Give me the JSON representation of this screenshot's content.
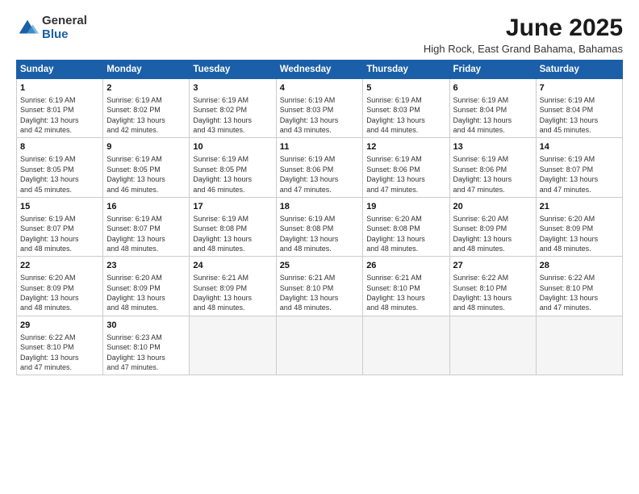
{
  "logo": {
    "general": "General",
    "blue": "Blue"
  },
  "title": "June 2025",
  "subtitle": "High Rock, East Grand Bahama, Bahamas",
  "weekdays": [
    "Sunday",
    "Monday",
    "Tuesday",
    "Wednesday",
    "Thursday",
    "Friday",
    "Saturday"
  ],
  "weeks": [
    [
      {
        "day": "1",
        "info": "Sunrise: 6:19 AM\nSunset: 8:01 PM\nDaylight: 13 hours\nand 42 minutes."
      },
      {
        "day": "2",
        "info": "Sunrise: 6:19 AM\nSunset: 8:02 PM\nDaylight: 13 hours\nand 42 minutes."
      },
      {
        "day": "3",
        "info": "Sunrise: 6:19 AM\nSunset: 8:02 PM\nDaylight: 13 hours\nand 43 minutes."
      },
      {
        "day": "4",
        "info": "Sunrise: 6:19 AM\nSunset: 8:03 PM\nDaylight: 13 hours\nand 43 minutes."
      },
      {
        "day": "5",
        "info": "Sunrise: 6:19 AM\nSunset: 8:03 PM\nDaylight: 13 hours\nand 44 minutes."
      },
      {
        "day": "6",
        "info": "Sunrise: 6:19 AM\nSunset: 8:04 PM\nDaylight: 13 hours\nand 44 minutes."
      },
      {
        "day": "7",
        "info": "Sunrise: 6:19 AM\nSunset: 8:04 PM\nDaylight: 13 hours\nand 45 minutes."
      }
    ],
    [
      {
        "day": "8",
        "info": "Sunrise: 6:19 AM\nSunset: 8:05 PM\nDaylight: 13 hours\nand 45 minutes."
      },
      {
        "day": "9",
        "info": "Sunrise: 6:19 AM\nSunset: 8:05 PM\nDaylight: 13 hours\nand 46 minutes."
      },
      {
        "day": "10",
        "info": "Sunrise: 6:19 AM\nSunset: 8:05 PM\nDaylight: 13 hours\nand 46 minutes."
      },
      {
        "day": "11",
        "info": "Sunrise: 6:19 AM\nSunset: 8:06 PM\nDaylight: 13 hours\nand 47 minutes."
      },
      {
        "day": "12",
        "info": "Sunrise: 6:19 AM\nSunset: 8:06 PM\nDaylight: 13 hours\nand 47 minutes."
      },
      {
        "day": "13",
        "info": "Sunrise: 6:19 AM\nSunset: 8:06 PM\nDaylight: 13 hours\nand 47 minutes."
      },
      {
        "day": "14",
        "info": "Sunrise: 6:19 AM\nSunset: 8:07 PM\nDaylight: 13 hours\nand 47 minutes."
      }
    ],
    [
      {
        "day": "15",
        "info": "Sunrise: 6:19 AM\nSunset: 8:07 PM\nDaylight: 13 hours\nand 48 minutes."
      },
      {
        "day": "16",
        "info": "Sunrise: 6:19 AM\nSunset: 8:07 PM\nDaylight: 13 hours\nand 48 minutes."
      },
      {
        "day": "17",
        "info": "Sunrise: 6:19 AM\nSunset: 8:08 PM\nDaylight: 13 hours\nand 48 minutes."
      },
      {
        "day": "18",
        "info": "Sunrise: 6:19 AM\nSunset: 8:08 PM\nDaylight: 13 hours\nand 48 minutes."
      },
      {
        "day": "19",
        "info": "Sunrise: 6:20 AM\nSunset: 8:08 PM\nDaylight: 13 hours\nand 48 minutes."
      },
      {
        "day": "20",
        "info": "Sunrise: 6:20 AM\nSunset: 8:09 PM\nDaylight: 13 hours\nand 48 minutes."
      },
      {
        "day": "21",
        "info": "Sunrise: 6:20 AM\nSunset: 8:09 PM\nDaylight: 13 hours\nand 48 minutes."
      }
    ],
    [
      {
        "day": "22",
        "info": "Sunrise: 6:20 AM\nSunset: 8:09 PM\nDaylight: 13 hours\nand 48 minutes."
      },
      {
        "day": "23",
        "info": "Sunrise: 6:20 AM\nSunset: 8:09 PM\nDaylight: 13 hours\nand 48 minutes."
      },
      {
        "day": "24",
        "info": "Sunrise: 6:21 AM\nSunset: 8:09 PM\nDaylight: 13 hours\nand 48 minutes."
      },
      {
        "day": "25",
        "info": "Sunrise: 6:21 AM\nSunset: 8:10 PM\nDaylight: 13 hours\nand 48 minutes."
      },
      {
        "day": "26",
        "info": "Sunrise: 6:21 AM\nSunset: 8:10 PM\nDaylight: 13 hours\nand 48 minutes."
      },
      {
        "day": "27",
        "info": "Sunrise: 6:22 AM\nSunset: 8:10 PM\nDaylight: 13 hours\nand 48 minutes."
      },
      {
        "day": "28",
        "info": "Sunrise: 6:22 AM\nSunset: 8:10 PM\nDaylight: 13 hours\nand 47 minutes."
      }
    ],
    [
      {
        "day": "29",
        "info": "Sunrise: 6:22 AM\nSunset: 8:10 PM\nDaylight: 13 hours\nand 47 minutes."
      },
      {
        "day": "30",
        "info": "Sunrise: 6:23 AM\nSunset: 8:10 PM\nDaylight: 13 hours\nand 47 minutes."
      },
      null,
      null,
      null,
      null,
      null
    ]
  ]
}
